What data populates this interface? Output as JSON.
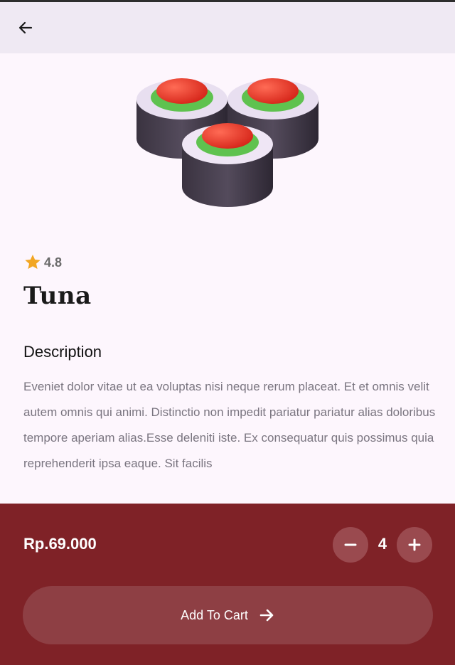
{
  "product": {
    "name": "Tuna",
    "rating": "4.8",
    "description_heading": "Description",
    "description": "Eveniet dolor vitae ut ea voluptas nisi neque rerum placeat. Et et omnis velit autem omnis qui animi. Distinctio non impedit pariatur pariatur alias doloribus tempore aperiam alias.Esse deleniti iste. Ex consequatur quis possimus quia reprehenderit ipsa eaque. Sit facilis",
    "price": "Rp.69.000",
    "quantity": "4"
  },
  "actions": {
    "add_to_cart_label": "Add To Cart"
  },
  "icons": {
    "back": "arrow-left-icon",
    "star": "star-icon",
    "minus": "minus-icon",
    "plus": "plus-icon",
    "cart_arrow": "arrow-right-icon"
  },
  "colors": {
    "background": "#fdf6fd",
    "top_bar": "#efe9f3",
    "bottom_panel": "#7f2227",
    "button_fill": "#8e3f44",
    "star": "#f2a623"
  }
}
